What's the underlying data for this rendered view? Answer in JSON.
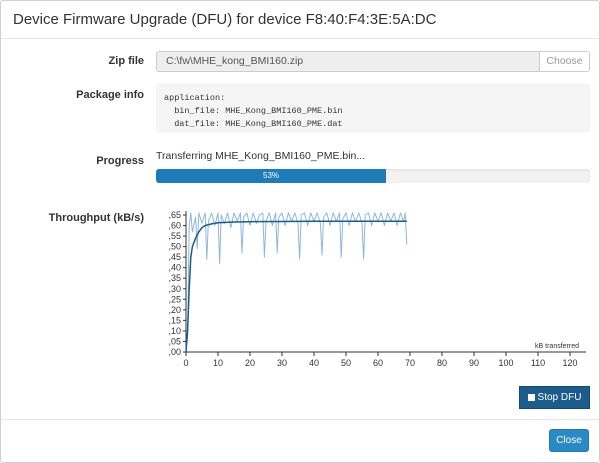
{
  "dialog": {
    "title": "Device Firmware Upgrade (DFU) for device F8:40:F4:3E:5A:DC"
  },
  "zip": {
    "label": "Zip file",
    "value": "C:\\fw\\MHE_kong_BMI160.zip",
    "choose_label": "Choose"
  },
  "package": {
    "label": "Package info",
    "text": "application:\n  bin_file: MHE_Kong_BMI160_PME.bin\n  dat_file: MHE_Kong_BMI160_PME.dat"
  },
  "progress": {
    "label": "Progress",
    "status": "Transferring MHE_Kong_BMI160_PME.bin...",
    "percent": 53,
    "percent_label": "53%"
  },
  "throughput": {
    "label": "Throughput (kB/s)"
  },
  "buttons": {
    "stop_dfu": "Stop DFU",
    "close": "Close"
  },
  "colors": {
    "accent": "#1c7bb8",
    "stop_button": "#1a5c8c",
    "close_button": "#2a8ac6",
    "line_raw": "#8fb7de",
    "line_avg": "#1a5c8c"
  },
  "chart_data": {
    "type": "line",
    "title": "",
    "xlabel": "kB transferred",
    "ylabel": "",
    "xlim": [
      0,
      125
    ],
    "ylim": [
      0,
      0.65
    ],
    "x_ticks": [
      "0",
      "10",
      "20",
      "30",
      "40",
      "50",
      "60",
      "70",
      "80",
      "90",
      "100",
      "110",
      "120"
    ],
    "y_ticks": [
      ",00",
      ",05",
      ",10",
      ",15",
      ",20",
      ",25",
      ",30",
      ",35",
      ",40",
      ",45",
      ",50",
      ",55",
      ",60",
      ",65"
    ],
    "y_tick_values": [
      0,
      0.05,
      0.1,
      0.15,
      0.2,
      0.25,
      0.3,
      0.35,
      0.4,
      0.45,
      0.5,
      0.55,
      0.6,
      0.65
    ],
    "series": [
      {
        "x": [
          0.5,
          1,
          1.5,
          2,
          3,
          3.5,
          4,
          5,
          6,
          6.5,
          7,
          8,
          9,
          10,
          10.5,
          11,
          12,
          13,
          14,
          15,
          16,
          17,
          17.5,
          18,
          19,
          20,
          21,
          22,
          23,
          24,
          24.5,
          25,
          26,
          27,
          28,
          28.5,
          29,
          30,
          31,
          32,
          33,
          34,
          35,
          35.5,
          36,
          37,
          38,
          39,
          40,
          41,
          42,
          42.5,
          43,
          44,
          45,
          46,
          47,
          48,
          48.5,
          49,
          50,
          51,
          52,
          53,
          54,
          55,
          55.5,
          56,
          57,
          58,
          59,
          60,
          61,
          62,
          63,
          64,
          65,
          66,
          67,
          68,
          68.5,
          69
        ],
        "values": [
          0.08,
          0.6,
          0.66,
          0.57,
          0.64,
          0.49,
          0.66,
          0.61,
          0.66,
          0.44,
          0.62,
          0.66,
          0.6,
          0.66,
          0.42,
          0.65,
          0.61,
          0.66,
          0.59,
          0.66,
          0.62,
          0.66,
          0.47,
          0.64,
          0.66,
          0.6,
          0.66,
          0.61,
          0.65,
          0.66,
          0.45,
          0.62,
          0.66,
          0.6,
          0.66,
          0.47,
          0.64,
          0.66,
          0.6,
          0.66,
          0.62,
          0.66,
          0.61,
          0.44,
          0.65,
          0.66,
          0.6,
          0.66,
          0.62,
          0.66,
          0.61,
          0.46,
          0.64,
          0.66,
          0.6,
          0.66,
          0.62,
          0.66,
          0.45,
          0.63,
          0.66,
          0.6,
          0.66,
          0.62,
          0.66,
          0.61,
          0.44,
          0.65,
          0.66,
          0.6,
          0.66,
          0.62,
          0.66,
          0.6,
          0.66,
          0.62,
          0.66,
          0.6,
          0.66,
          0.62,
          0.66,
          0.51
        ]
      },
      {
        "x": [
          0,
          0.5,
          1,
          1.5,
          2,
          3,
          4,
          5,
          6,
          8,
          10,
          15,
          20,
          30,
          40,
          50,
          60,
          69
        ],
        "values": [
          0.0,
          0.1,
          0.3,
          0.45,
          0.5,
          0.54,
          0.57,
          0.59,
          0.6,
          0.608,
          0.613,
          0.617,
          0.618,
          0.619,
          0.62,
          0.62,
          0.62,
          0.62
        ]
      }
    ]
  }
}
